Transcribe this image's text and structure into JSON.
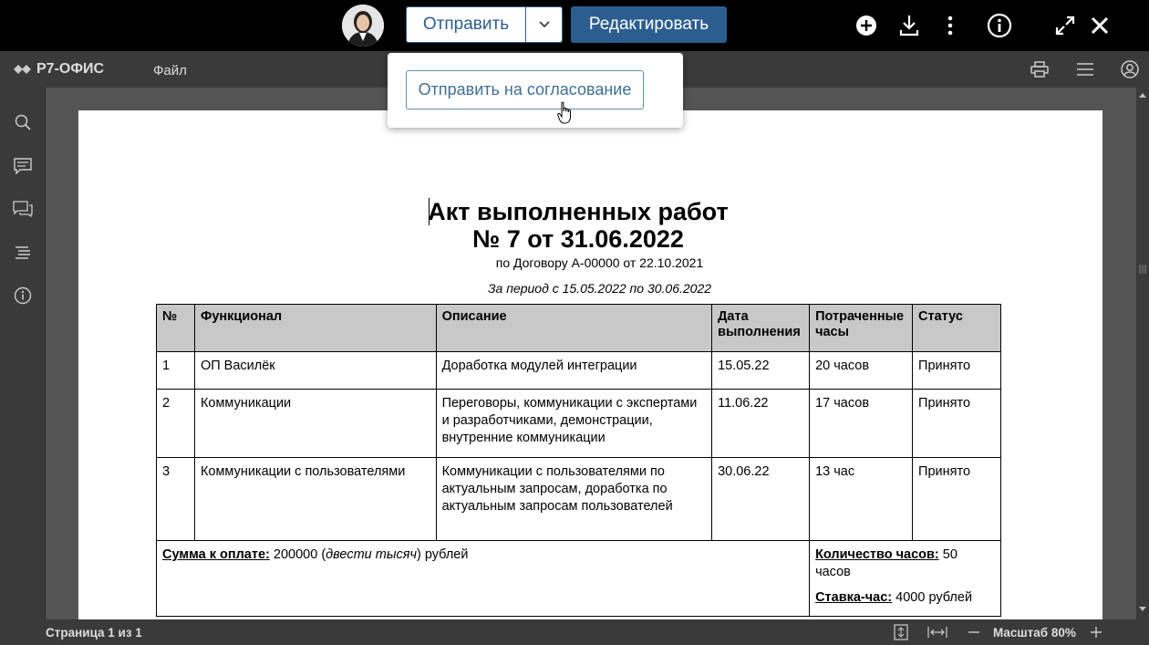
{
  "topbar": {
    "send_label": "Отправить",
    "edit_label": "Редактировать",
    "dropdown_item": "Отправить на согласование"
  },
  "editor": {
    "logo_text": "Р7-ОФИС",
    "file_menu": "Файл"
  },
  "document": {
    "title_line1": "Акт выполненных работ",
    "title_line2": "№ 7 от 31.06.2022",
    "contract": "по Договору А-00000 от 22.10.2021",
    "period": "За период с 15.05.2022 по 30.06.2022",
    "headers": [
      "№",
      "Функционал",
      "Описание",
      "Дата выполнения",
      "Потраченные часы",
      "Статус"
    ],
    "rows": [
      [
        "1",
        "ОП Василёк",
        "Доработка модулей интеграции",
        "15.05.22",
        "20 часов",
        "Принято"
      ],
      [
        "2",
        "Коммуникации",
        "Переговоры, коммуникации с экспертами и разработчиками, демонстрации, внутренние коммуникации",
        "11.06.22",
        "17 часов",
        "Принято"
      ],
      [
        "3",
        "Коммуникации с пользователями",
        "Коммуникации с пользователями по актуальным запросам, доработка по актуальным запросам пользователей",
        "30.06.22",
        "13 час",
        "Принято"
      ]
    ],
    "sum_label": "Сумма к оплате:",
    "sum_value_pre": " 200000 (",
    "sum_words": "двести тысяч",
    "sum_value_post": ") рублей",
    "hours_label": "Количество часов:",
    "hours_value": " 50 часов",
    "rate_label": "Ставка-час:",
    "rate_value": " 4000 рублей"
  },
  "statusbar": {
    "page_info": "Страница 1 из 1",
    "zoom": "Масштаб 80%"
  },
  "icons": [
    "plus-icon",
    "download-icon",
    "more-vertical-icon",
    "info-icon",
    "fullscreen-icon",
    "close-icon",
    "print-icon",
    "menu-icon",
    "user-icon",
    "search-icon",
    "comment-icon",
    "chat-icon",
    "navigation-icon",
    "about-icon"
  ],
  "colors": {
    "primary": "#2b5e8e",
    "topbar": "#000000",
    "editor_chrome": "#3a3a3a",
    "workspace": "#545454",
    "table_header": "#c8c8c8"
  }
}
